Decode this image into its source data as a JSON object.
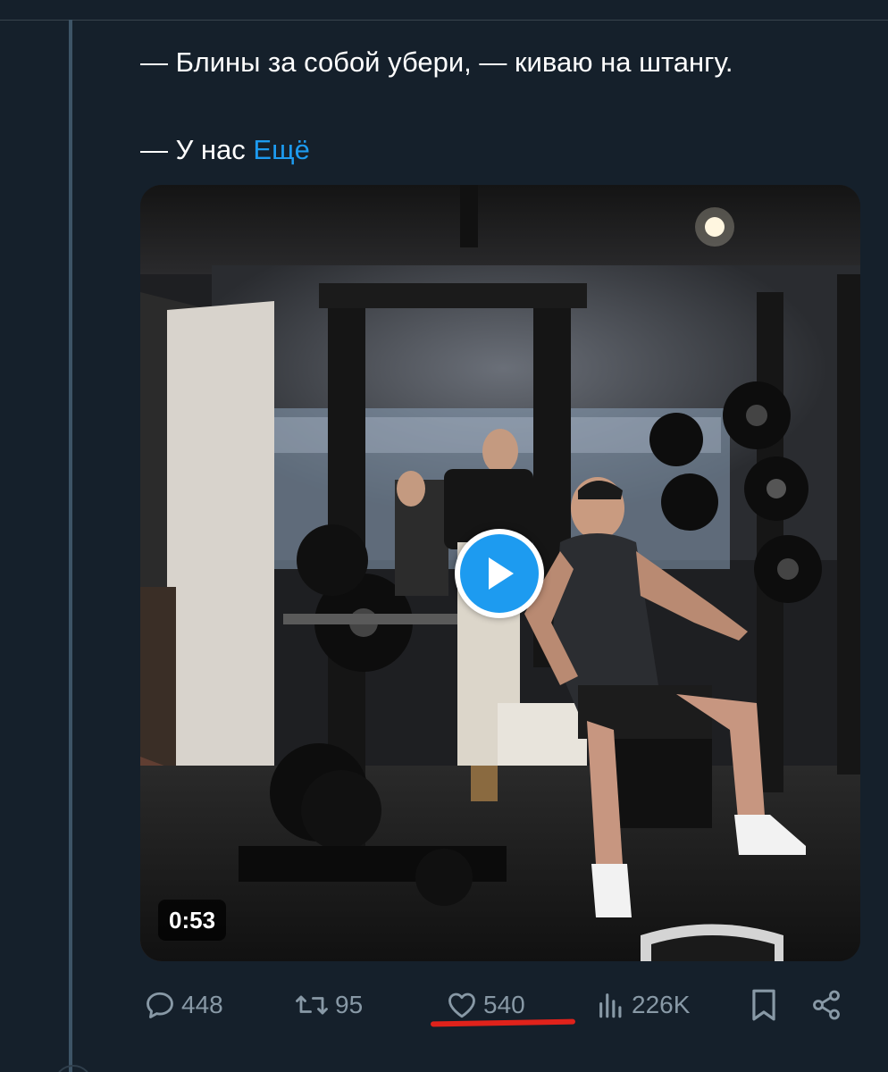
{
  "tweet": {
    "line1": "— Блины за собой убери, — киваю на штангу.",
    "line2_prefix": "— У нас ",
    "more_link": "Ещё"
  },
  "media": {
    "duration": "0:53"
  },
  "actions": {
    "replies": "448",
    "retweets": "95",
    "likes": "540",
    "views": "226K"
  },
  "colors": {
    "background": "#15202b",
    "accent": "#1d9bf0",
    "muted": "#8899a6",
    "highlight": "#e0221b"
  },
  "icons": [
    "reply-icon",
    "retweet-icon",
    "like-icon",
    "views-icon",
    "bookmark-icon",
    "share-icon",
    "play-icon"
  ]
}
